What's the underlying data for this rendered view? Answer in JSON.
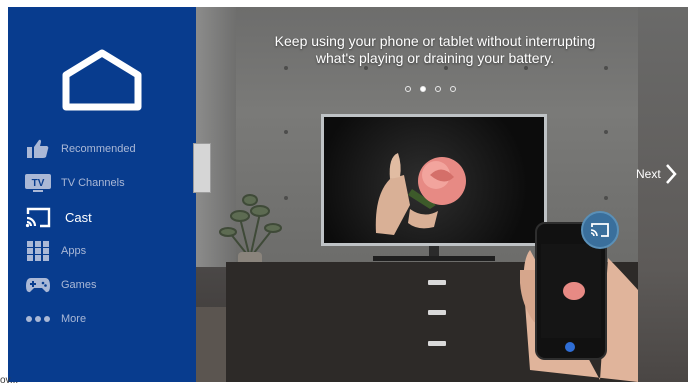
{
  "sidebar": {
    "items": [
      {
        "label": "Recommended",
        "icon": "thumbs-up-icon"
      },
      {
        "label": "TV Channels",
        "icon": "tv-icon",
        "badge": "TV"
      },
      {
        "label": "Cast",
        "icon": "cast-icon",
        "active": true
      },
      {
        "label": "Apps",
        "icon": "apps-grid-icon"
      },
      {
        "label": "Games",
        "icon": "gamepad-icon"
      },
      {
        "label": "More",
        "icon": "more-dots-icon"
      }
    ]
  },
  "hero": {
    "caption_line1": "Keep using your phone or tablet without interrupting",
    "caption_line2": "what's playing or draining your battery.",
    "pager": {
      "count": 4,
      "active_index": 1
    }
  },
  "navigation": {
    "next_label": "Next"
  },
  "footer": {
    "text": "ov..."
  },
  "colors": {
    "sidebar": "#083c8e",
    "accent": "#3a6f9c"
  }
}
